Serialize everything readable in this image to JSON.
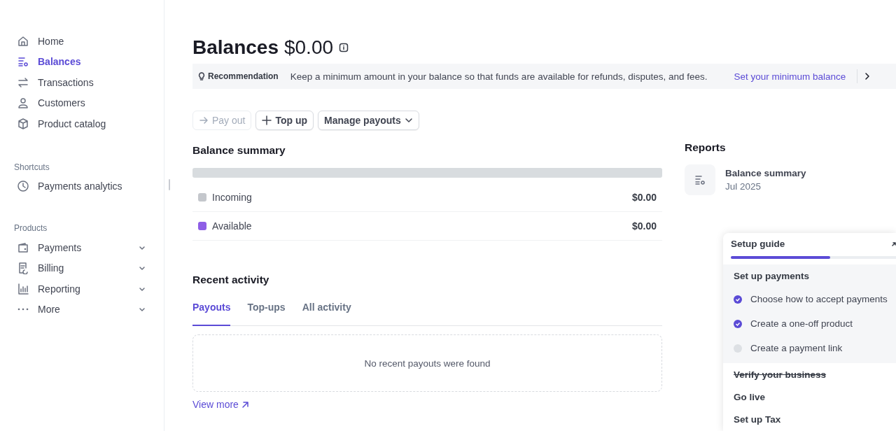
{
  "sidebar": {
    "nav": [
      {
        "label": "Home",
        "selected": false
      },
      {
        "label": "Balances",
        "selected": true
      },
      {
        "label": "Transactions",
        "selected": false
      },
      {
        "label": "Customers",
        "selected": false
      },
      {
        "label": "Product catalog",
        "selected": false
      }
    ],
    "sections": [
      {
        "title": "Shortcuts",
        "items": [
          {
            "label": "Payments analytics"
          }
        ]
      },
      {
        "title": "Products",
        "items": [
          {
            "label": "Payments",
            "expanded": false
          },
          {
            "label": "Billing",
            "expanded": false
          },
          {
            "label": "Reporting",
            "expanded": false
          },
          {
            "label": "More",
            "expanded": false
          }
        ]
      }
    ]
  },
  "header": {
    "title": "Balances",
    "amount": "$0.00"
  },
  "recommendation": {
    "label": "Recommendation",
    "text": "Keep a minimum amount in your balance so that funds are available for refunds, disputes, and fees.",
    "link": "Set your minimum balance"
  },
  "actions": [
    {
      "label": "Pay out",
      "kind": "payout",
      "disabled": true
    },
    {
      "label": "Top up",
      "kind": "topup",
      "disabled": false
    },
    {
      "label": "Manage payouts",
      "kind": "menu",
      "disabled": false
    }
  ],
  "balance_summary": {
    "title": "Balance summary",
    "legend": [
      {
        "label": "Incoming",
        "amount": "$0.00",
        "color": "#c4c7cc"
      },
      {
        "label": "Available",
        "amount": "$0.00",
        "color": "#8e5ee6"
      }
    ]
  },
  "recent_activity": {
    "title": "Recent activity",
    "tabs": [
      {
        "label": "Payouts",
        "selected": true
      },
      {
        "label": "Top-ups",
        "selected": false
      },
      {
        "label": "All activity",
        "selected": false
      }
    ],
    "empty_message": "No recent payouts were found",
    "link": "View more"
  },
  "reports": {
    "title": "Reports",
    "items": [
      {
        "title": "Balance summary",
        "subtitle": "Jul 2025"
      }
    ]
  },
  "setup_guide": {
    "title": "Setup guide",
    "level": 0.6,
    "groups": [
      {
        "title": "Set up payments",
        "done": false,
        "expanded": true,
        "tasks": [
          {
            "label": "Choose how to accept payments",
            "done": true
          },
          {
            "label": "Create a one-off product",
            "done": true
          },
          {
            "label": "Create a payment link",
            "done": false
          }
        ]
      },
      {
        "title": "Verify your business",
        "done": true,
        "expanded": false
      },
      {
        "title": "Go live",
        "done": false,
        "expanded": false
      },
      {
        "title": "Set up Tax",
        "done": false,
        "expanded": false
      }
    ]
  }
}
